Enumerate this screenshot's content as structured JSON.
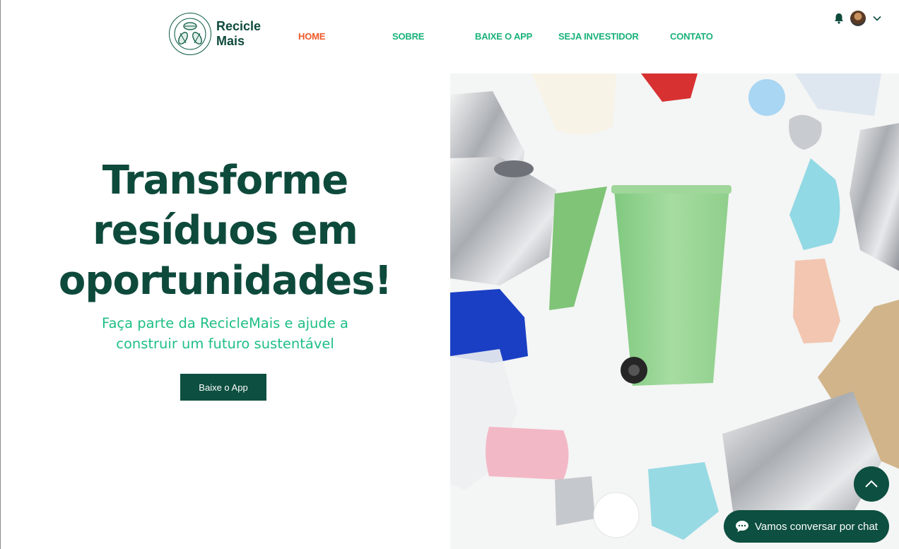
{
  "brand": {
    "line1": "Recicle",
    "line2": "Mais",
    "primary_color": "#0e4a3c",
    "accent_color": "#19b27a",
    "active_color": "#ef5a28"
  },
  "nav": [
    {
      "label": "HOME",
      "active": true
    },
    {
      "label": "SOBRE",
      "active": false
    },
    {
      "label": "BAIXE O APP",
      "active": false
    },
    {
      "label": "SEJA INVESTIDOR",
      "active": false
    },
    {
      "label": "CONTATO",
      "active": false
    }
  ],
  "user": {
    "notification_icon": "bell-icon",
    "avatar": "user-avatar",
    "menu_icon": "chevron-down-icon"
  },
  "hero": {
    "title": "Transforme resíduos em oportunidades!",
    "subtitle": "Faça parte da RecicleMais e ajude a construir um futuro sustentável",
    "cta_label": "Baixe o App"
  },
  "floating": {
    "scroll_top_icon": "chevron-up-icon",
    "chat_icon": "chat-bubble-icon",
    "chat_label": "Vamos conversar por chat"
  }
}
